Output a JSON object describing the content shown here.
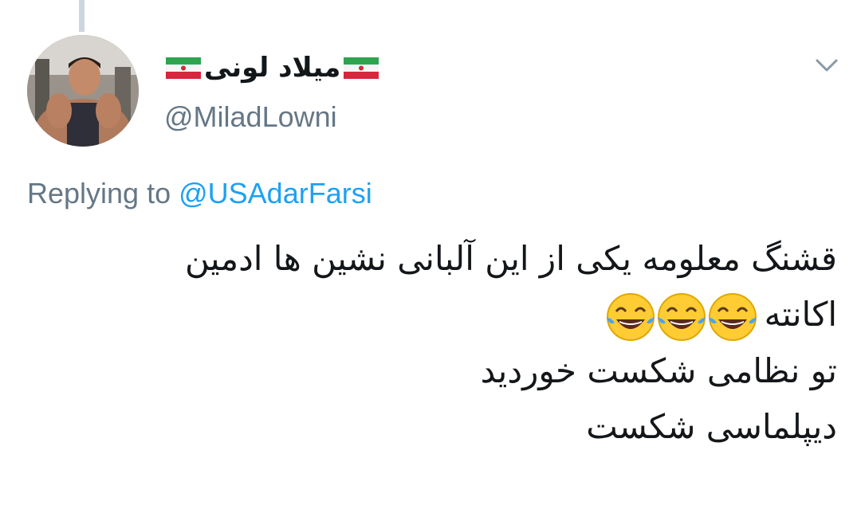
{
  "tweet": {
    "author": {
      "display_name": "میلاد لونی",
      "handle": "@MiladLowni"
    },
    "reply": {
      "prefix": "Replying to ",
      "mention": "@USAdarFarsi"
    },
    "body": {
      "line1": "قشنگ معلومه یکی از این آلبانی نشین ها ادمین",
      "line2": "اکانته",
      "line3": "تو نظامی شکست خوردید",
      "line4": "دیپلماسی شکست"
    },
    "icons": {
      "flag": "iran-flag-emoji",
      "emoji": "face-with-tears-of-joy",
      "menu": "chevron-down-icon"
    }
  },
  "colors": {
    "text": "#14171a",
    "secondary": "#657786",
    "link": "#1da1f2",
    "thread_line": "#ccd6dd"
  }
}
